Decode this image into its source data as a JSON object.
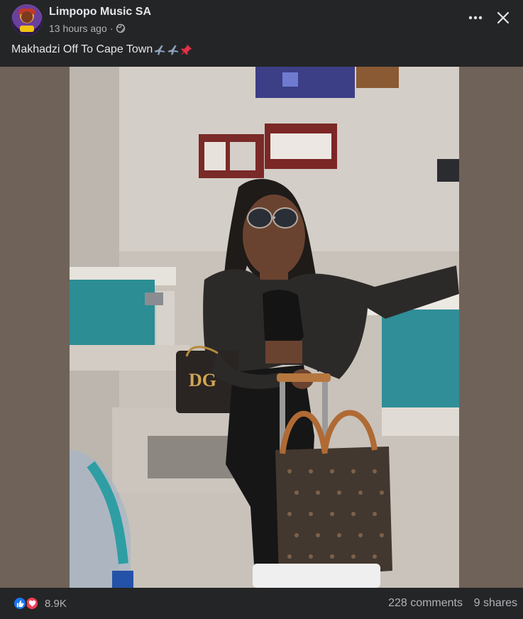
{
  "post": {
    "page_name": "Limpopo Music SA",
    "timestamp": "13 hours ago",
    "separator": "·",
    "audience_icon": "globe-icon",
    "caption_text": "Makhadzi Off To Cape Town",
    "caption_emojis": [
      "airplane-icon",
      "airplane-icon",
      "pushpin-icon"
    ]
  },
  "header_actions": {
    "more_icon": "more-horizontal-icon",
    "close_icon": "close-icon"
  },
  "photo": {
    "subject": "photo"
  },
  "footer": {
    "reaction_icons": [
      "like-icon",
      "love-icon"
    ],
    "reaction_count": "8.9K",
    "comments": "228 comments",
    "shares": "9 shares"
  },
  "colors": {
    "background": "#242526",
    "text_primary": "#e4e6eb",
    "text_secondary": "#b0b3b8",
    "like_blue": "#1877f2",
    "love_red": "#f33e58",
    "photo_letterbox": "#6f6259"
  }
}
